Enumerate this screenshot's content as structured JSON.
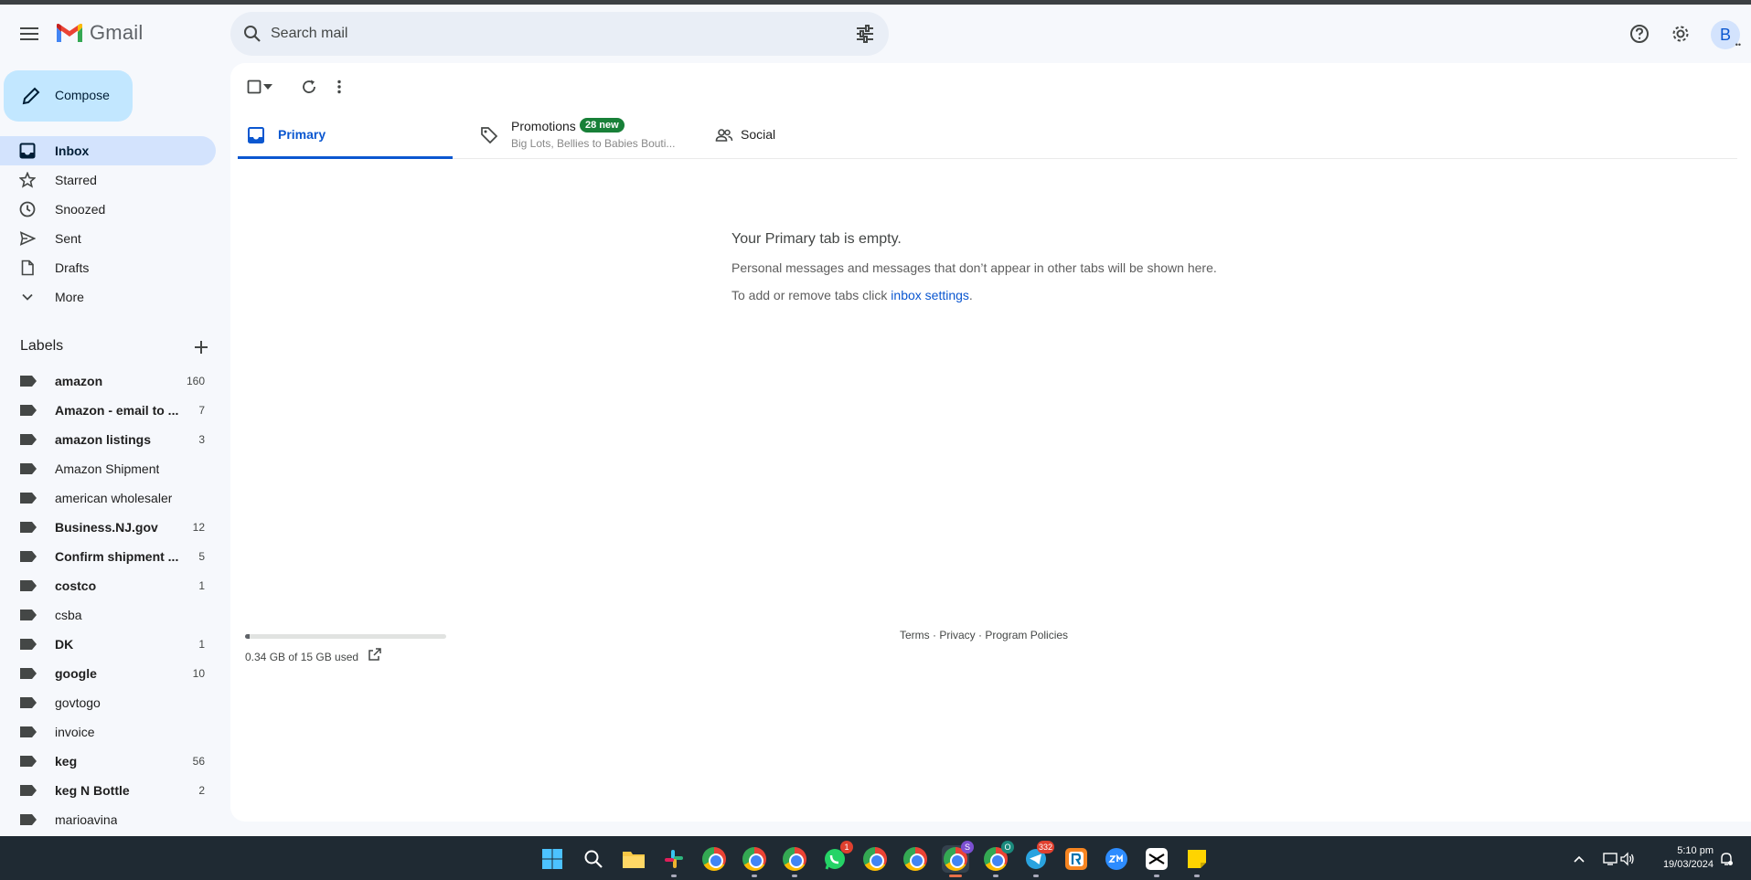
{
  "app": {
    "name": "Gmail"
  },
  "header": {
    "search_placeholder": "Search mail",
    "avatar_letter": "B"
  },
  "sidebar": {
    "compose_label": "Compose",
    "items": [
      {
        "label": "Inbox",
        "icon": "inbox-icon",
        "active": true
      },
      {
        "label": "Starred",
        "icon": "star-icon"
      },
      {
        "label": "Snoozed",
        "icon": "clock-icon"
      },
      {
        "label": "Sent",
        "icon": "send-icon"
      },
      {
        "label": "Drafts",
        "icon": "draft-icon"
      },
      {
        "label": "More",
        "icon": "chevron-down-icon"
      }
    ],
    "labels_title": "Labels",
    "labels": [
      {
        "name": "amazon",
        "count": "160",
        "bold": true
      },
      {
        "name": "Amazon - email to ...",
        "count": "7",
        "bold": true
      },
      {
        "name": "amazon listings",
        "count": "3",
        "bold": true
      },
      {
        "name": "Amazon Shipment",
        "count": "",
        "bold": false
      },
      {
        "name": "american wholesaler",
        "count": "",
        "bold": false
      },
      {
        "name": "Business.NJ.gov",
        "count": "12",
        "bold": true
      },
      {
        "name": "Confirm shipment ...",
        "count": "5",
        "bold": true
      },
      {
        "name": "costco",
        "count": "1",
        "bold": true
      },
      {
        "name": "csba",
        "count": "",
        "bold": false
      },
      {
        "name": "DK",
        "count": "1",
        "bold": true
      },
      {
        "name": "google",
        "count": "10",
        "bold": true
      },
      {
        "name": "govtogo",
        "count": "",
        "bold": false
      },
      {
        "name": "invoice",
        "count": "",
        "bold": false
      },
      {
        "name": "keg",
        "count": "56",
        "bold": true
      },
      {
        "name": "keg N Bottle",
        "count": "2",
        "bold": true
      },
      {
        "name": "marioavina",
        "count": "",
        "bold": false
      }
    ]
  },
  "tabs": {
    "primary": "Primary",
    "promotions": "Promotions",
    "promotions_badge": "28 new",
    "promotions_sub": "Big Lots, Bellies to Babies Bouti...",
    "social": "Social"
  },
  "empty_state": {
    "heading": "Your Primary tab is empty.",
    "line1": "Personal messages and messages that don’t appear in other tabs will be shown here.",
    "line2_prefix": "To add or remove tabs click ",
    "line2_link": "inbox settings",
    "line2_suffix": "."
  },
  "storage": {
    "text": "0.34 GB of 15 GB used",
    "fraction_used": 0.0227
  },
  "footer": {
    "terms": "Terms",
    "sep1": " · ",
    "privacy": "Privacy",
    "sep2": " · ",
    "policies": "Program Policies"
  },
  "taskbar": {
    "badges": {
      "whatsapp": "1",
      "chrome_profile_s": "S",
      "chrome_profile_o": "O",
      "telegram": "332"
    },
    "time": "5:10 pm",
    "date": "19/03/2024"
  }
}
